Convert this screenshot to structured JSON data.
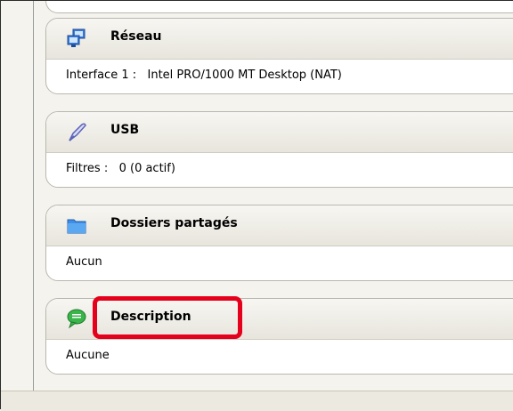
{
  "sections": [
    {
      "title": "Réseau",
      "icon": "network-icon",
      "lines": [
        "Interface 1 :   Intel PRO/1000 MT Desktop (NAT)"
      ]
    },
    {
      "title": "USB",
      "icon": "usb-icon",
      "lines": [
        "Filtres :   0 (0 actif)"
      ]
    },
    {
      "title": "Dossiers partagés",
      "icon": "folder-icon",
      "lines": [
        "Aucun"
      ]
    },
    {
      "title": "Description",
      "icon": "speech-bubble-icon",
      "lines": [
        "Aucune"
      ]
    }
  ],
  "colors": {
    "highlight": "#e5001c"
  }
}
